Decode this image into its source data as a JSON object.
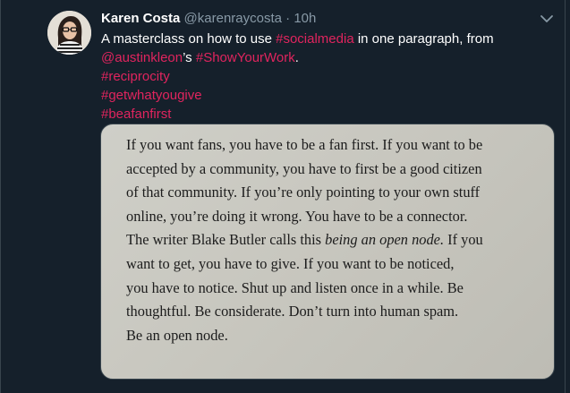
{
  "tweet": {
    "author_name": "Karen Costa",
    "handle": "@karenraycosta",
    "separator": "·",
    "time": "10h",
    "line1": "A masterclass on how to use ",
    "line1_tag": "#socialmedia",
    "line1_end": " in one paragraph, from",
    "mention": "@austinkleon",
    "mention_suffix": "’s ",
    "line2_tag": "#ShowYourWork",
    "line2_end": ".",
    "hashtags": [
      "#reciprocity",
      "#getwhatyougive",
      "#beafanfirst"
    ],
    "icons": {
      "avatar": "avatar-photo",
      "menu": "chevron-down-icon"
    },
    "colors": {
      "background": "#15202b",
      "accent": "#e0245e",
      "secondary_text": "#8899a6"
    }
  },
  "image_text": {
    "lines": [
      "If you want fans, you have to be a fan first. If you want to be",
      "accepted by a community, you have to first be a good citizen",
      "of that community. If you’re only pointing to your own stuff",
      "online, you’re doing it wrong. You have to be a connector.",
      "The writer Blake Butler calls this ",
      "being an open node.",
      " If you",
      "want to get, you have to give. If you want to be noticed,",
      "you have to notice. Shut up and listen once in a while. Be",
      "thoughtful. Be considerate. Don’t turn into human spam.",
      "Be an open node."
    ]
  }
}
